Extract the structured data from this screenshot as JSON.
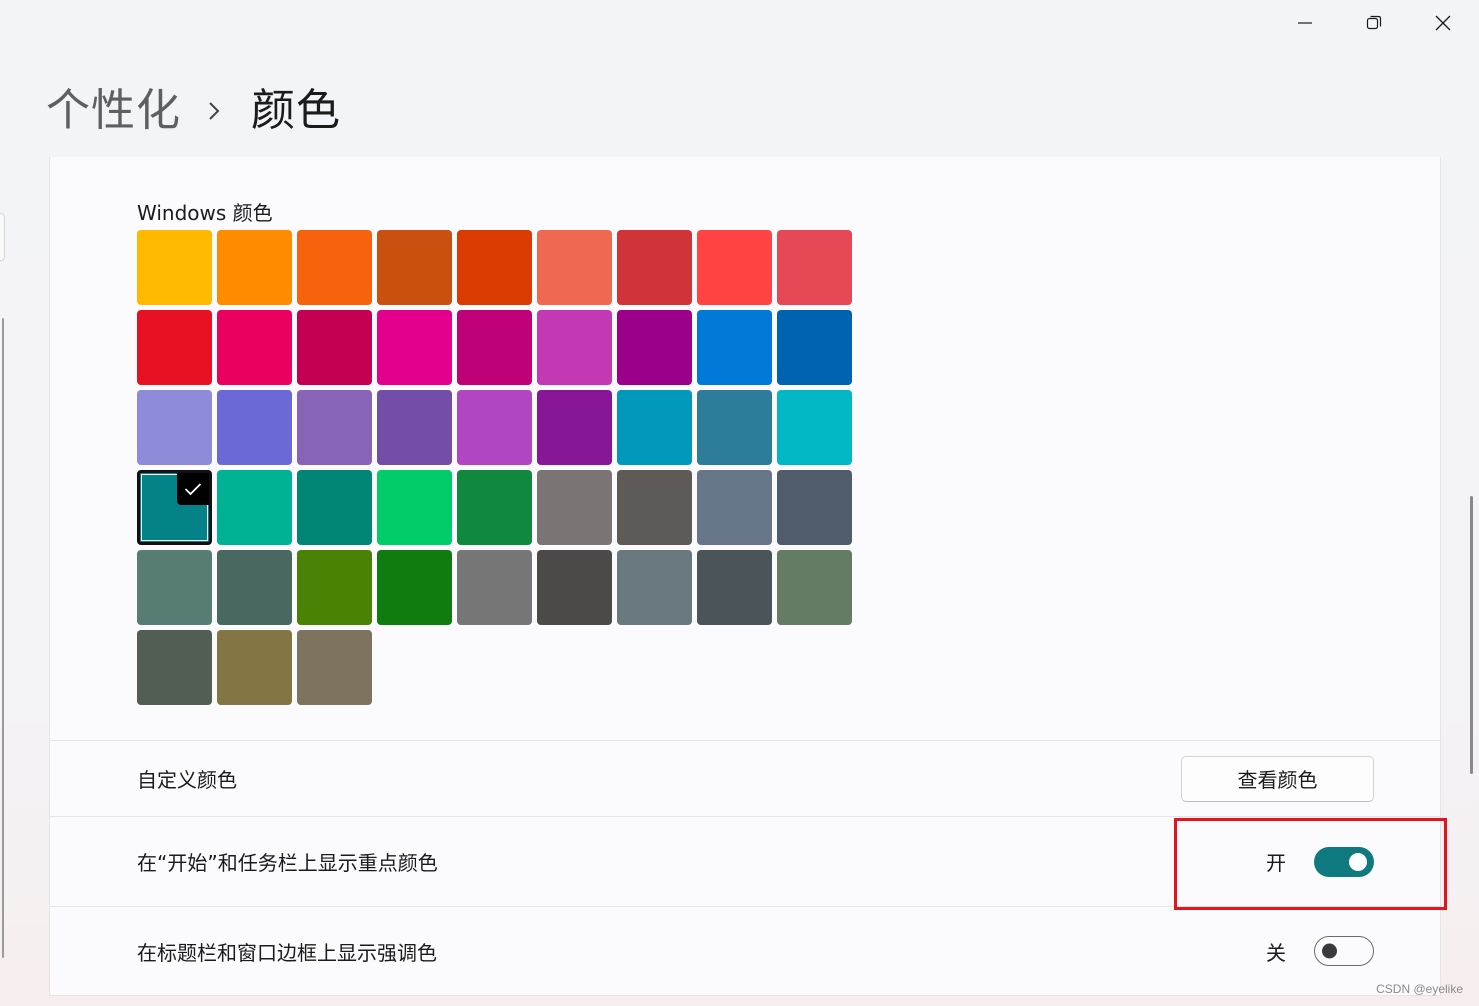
{
  "window_controls": {
    "minimize_icon": "minimize-icon",
    "restore_icon": "restore-icon",
    "close_icon": "close-icon"
  },
  "breadcrumb": {
    "parent": "个性化",
    "separator_icon": "chevron-right-icon",
    "current": "颜色"
  },
  "windows_colors": {
    "label": "Windows 颜色",
    "selected_index": 27,
    "swatches": [
      "#ffb900",
      "#ff8c00",
      "#f7630c",
      "#ca5010",
      "#da3b01",
      "#ef6950",
      "#d13438",
      "#ff4343",
      "#e74856",
      "#e81123",
      "#ea005e",
      "#c30052",
      "#e3008c",
      "#bf0077",
      "#c239b3",
      "#9a0089",
      "#0078d7",
      "#0063b1",
      "#8e8cd8",
      "#6b69d6",
      "#8764b8",
      "#744da9",
      "#b146c2",
      "#881798",
      "#0099bc",
      "#2d7d9a",
      "#00b7c3",
      "#038387",
      "#00b294",
      "#018574",
      "#00cc6a",
      "#10893e",
      "#7a7574",
      "#5d5a58",
      "#68768a",
      "#515c6b",
      "#567c73",
      "#486860",
      "#498205",
      "#107c10",
      "#767676",
      "#4c4a48",
      "#69797e",
      "#4a5459",
      "#647c64",
      "#525e54",
      "#847545",
      "#7e735f"
    ]
  },
  "custom_color": {
    "label": "自定义颜色",
    "button_label": "查看颜色"
  },
  "start_taskbar_accent": {
    "label": "在“开始”和任务栏上显示重点颜色",
    "state_label": "开",
    "on": true
  },
  "titlebar_accent": {
    "label": "在标题栏和窗口边框上显示强调色",
    "state_label": "关",
    "on": false
  },
  "watermark": "CSDN @eyelike",
  "colors": {
    "accent": "#0e7a7f",
    "highlight_box": "#e2141c"
  }
}
